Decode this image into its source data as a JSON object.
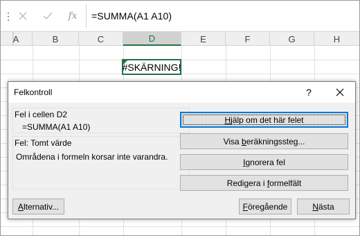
{
  "formula_bar": {
    "cancel_icon": "x-icon",
    "enter_icon": "check-icon",
    "fx_label": "fx",
    "formula": "=SUMMA(A1 A10)"
  },
  "columns": [
    "A",
    "B",
    "C",
    "D",
    "E",
    "F",
    "G",
    "H"
  ],
  "active_column": "D",
  "active_cell": {
    "address": "D2",
    "value": "#SKÄRNING!"
  },
  "dialog": {
    "title": "Felkontroll",
    "help_label": "?",
    "close_icon": "close-icon",
    "cell_label": "Fel i cellen D2",
    "cell_formula": "=SUMMA(A1 A10)",
    "error_label": "Fel: Tomt värde",
    "error_description": "Områdena i formeln korsar inte varandra.",
    "buttons": {
      "help": {
        "pre": "",
        "u": "H",
        "post": "jälp om det här felet"
      },
      "show_steps": {
        "pre": "Visa ",
        "u": "b",
        "post": "eräkningssteg..."
      },
      "ignore": {
        "pre": "",
        "u": "I",
        "post": "gnorera fel"
      },
      "edit": {
        "pre": "Redigera i ",
        "u": "f",
        "post": "ormelfält"
      },
      "options": {
        "pre": "",
        "u": "A",
        "post": "lternativ..."
      },
      "previous": {
        "pre": "",
        "u": "F",
        "post": "öregående"
      },
      "next": {
        "pre": "",
        "u": "N",
        "post": "ästa"
      }
    }
  },
  "colors": {
    "accent": "#217346",
    "focus": "#0078d7"
  }
}
